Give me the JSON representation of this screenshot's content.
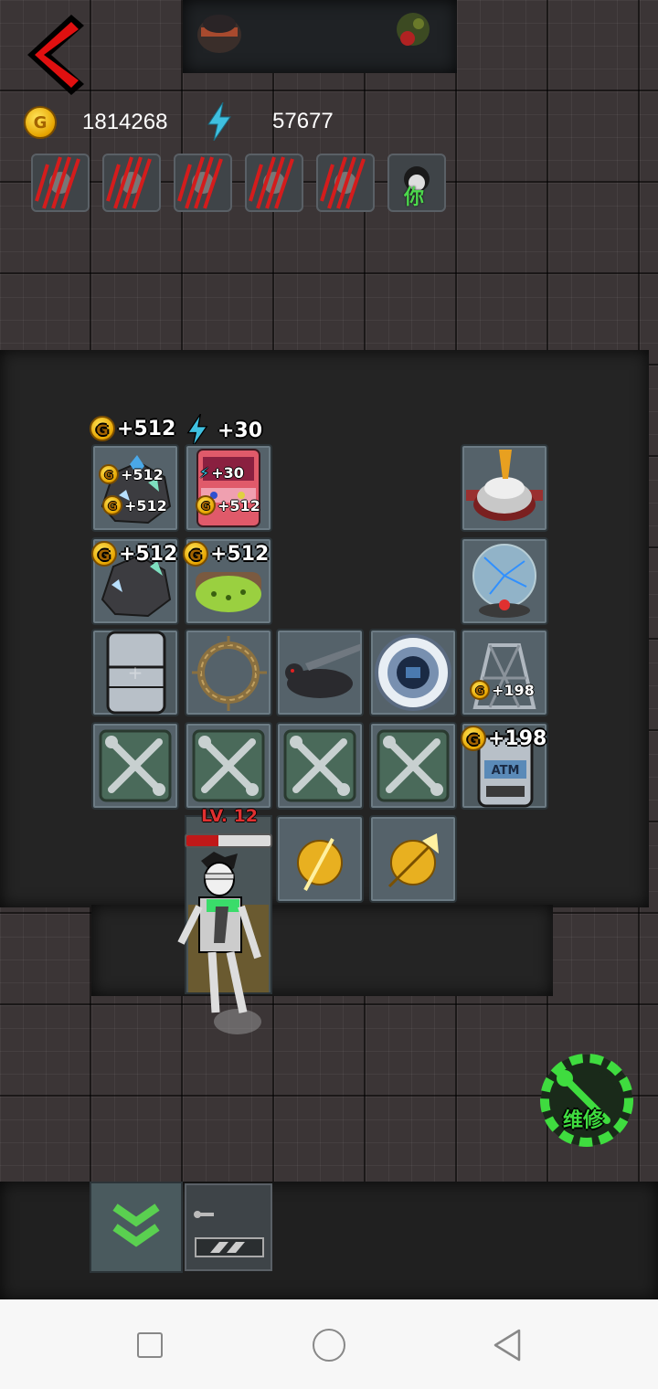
{
  "hud": {
    "gold": "1814268",
    "energy": "57677",
    "back_button": "back-arrow-icon",
    "coin_glyph": "G"
  },
  "hunters": [
    {
      "status": "slashed"
    },
    {
      "status": "slashed"
    },
    {
      "status": "slashed"
    },
    {
      "status": "slashed"
    },
    {
      "status": "slashed"
    },
    {
      "status": "you",
      "label": "你"
    }
  ],
  "income": {
    "room_gold": "+512",
    "room_energy": "+30",
    "crystal_1_a": "+512",
    "crystal_1_b": "+512",
    "arcade_energy": "+30",
    "arcade_gold": "+512",
    "crystal_2": "+512",
    "bed": "+512",
    "generator": "+198",
    "atm": "+198"
  },
  "player": {
    "level": "LV. 12",
    "hp_fraction": 0.38
  },
  "buttons": {
    "repair": "维修"
  },
  "colors": {
    "accent_green": "#3fdc3f",
    "coin_gold": "#f2b705",
    "energy_blue": "#3fc0e0",
    "back_red": "#e01010",
    "hp_red": "#c01818"
  },
  "tiles": {
    "row1": [
      "crystal-ore",
      "arcade-machine",
      "",
      "",
      "war-drum"
    ],
    "row2": [
      "crystal-ore",
      "green-bed",
      "",
      "",
      "plasma-globe"
    ],
    "row3": [
      "fridge",
      "thorn-wreath",
      "black-dog-sword",
      "vault-door",
      "generator-frame"
    ],
    "row4": [
      "wrench-slot",
      "wrench-slot",
      "wrench-slot",
      "wrench-slot",
      "atm"
    ],
    "row5": [
      "player-door",
      "golden-sword-orb",
      "golden-axe-orb"
    ]
  }
}
